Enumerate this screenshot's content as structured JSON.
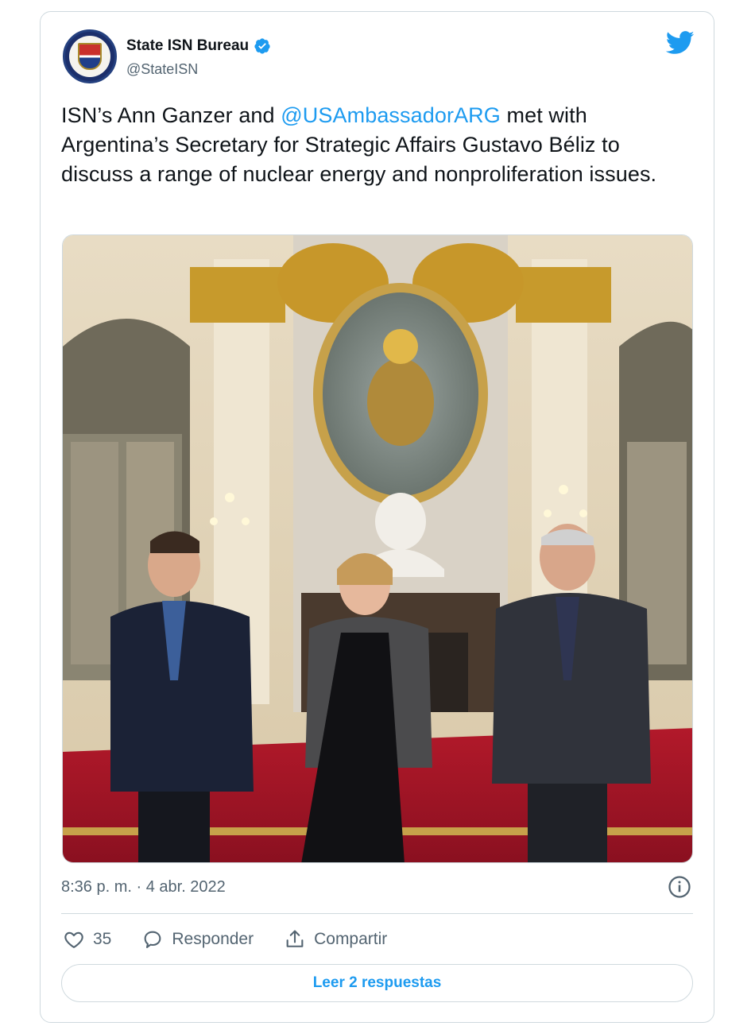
{
  "author": {
    "display_name": "State ISN Bureau",
    "handle": "@StateISN",
    "verified": true,
    "avatar_icon": "state-department-seal-icon"
  },
  "tweet": {
    "text_part1": "ISN’s Ann Ganzer and ",
    "mention": "@USAmbassadorARG",
    "text_part2": " met with Argentina’s Secretary for Strategic Affairs Gustavo Béliz to discuss a range of nuclear energy and nonproliferation issues.",
    "timestamp": "8:36 p. m. · 4 abr. 2022"
  },
  "actions": {
    "likes_count": "35",
    "reply_label": "Responder",
    "share_label": "Compartir"
  },
  "read_replies_label": "Leer 2 respuestas",
  "colors": {
    "link": "#1d9bf0",
    "text": "#0f1419",
    "muted": "#536471",
    "border": "#cfd9de"
  }
}
